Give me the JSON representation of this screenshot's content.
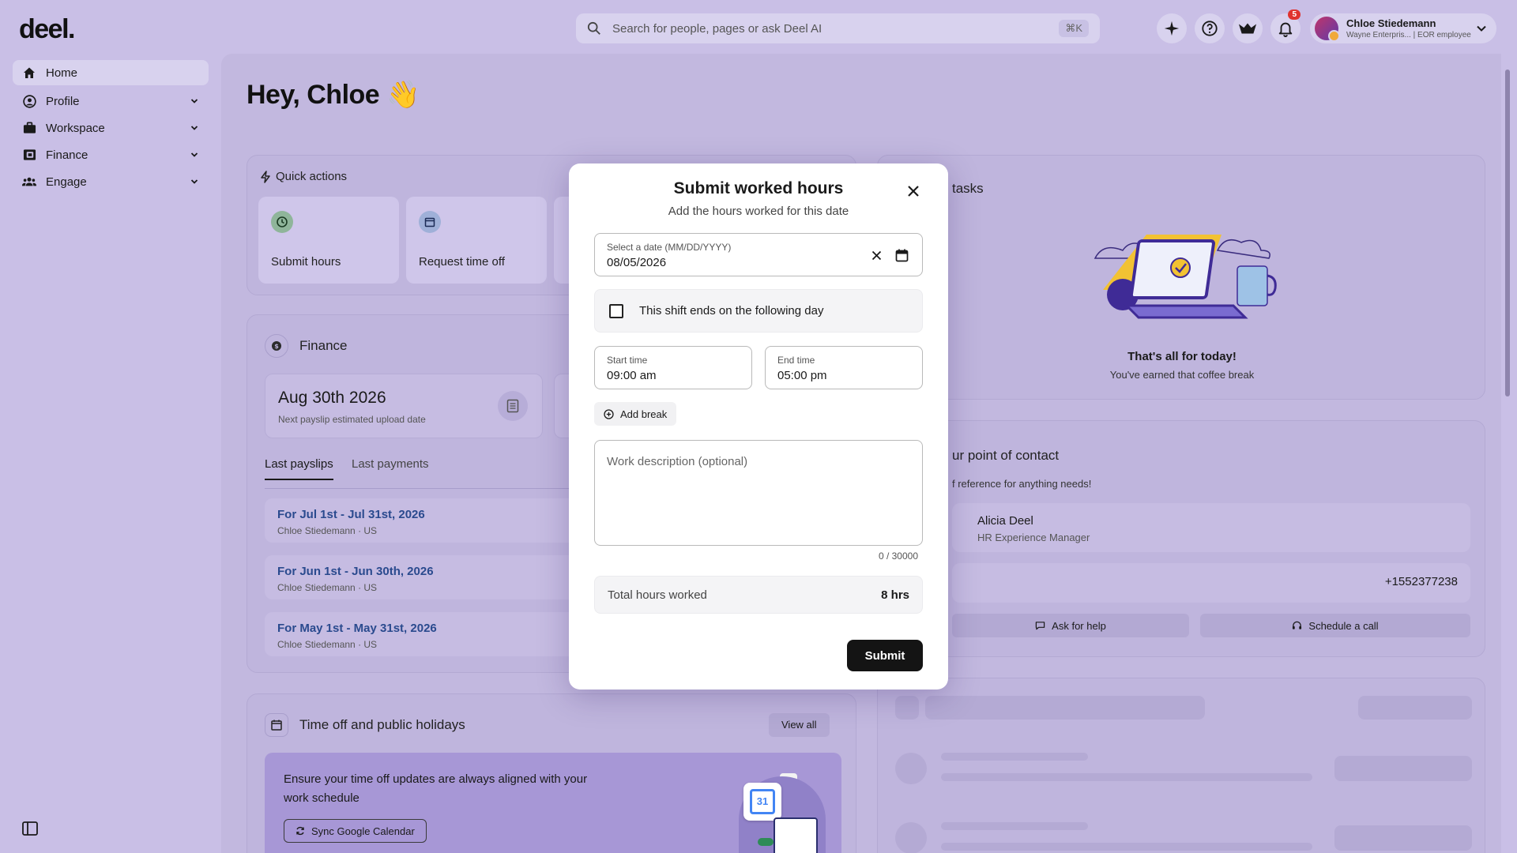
{
  "app": {
    "logo": "deel."
  },
  "topbar": {
    "search_placeholder": "Search for people, pages or ask Deel AI",
    "search_shortcut": "⌘K",
    "icons": [
      "ai-sparkle-icon",
      "help-icon",
      "explore-icon",
      "bell-icon"
    ],
    "notifications_count": "5",
    "user": {
      "name": "Chloe Stiedemann",
      "role": "Wayne Enterpris... | EOR employee"
    }
  },
  "sidebar": {
    "items": [
      {
        "label": "Home",
        "icon": "home-icon",
        "active": true,
        "expandable": false
      },
      {
        "label": "Profile",
        "icon": "profile-icon",
        "active": false,
        "expandable": true
      },
      {
        "label": "Workspace",
        "icon": "briefcase-icon",
        "active": false,
        "expandable": true
      },
      {
        "label": "Finance",
        "icon": "finance-icon",
        "active": false,
        "expandable": true
      },
      {
        "label": "Engage",
        "icon": "people-icon",
        "active": false,
        "expandable": true
      }
    ]
  },
  "main": {
    "greeting": "Hey, Chloe 👋",
    "quick_actions": {
      "title": "Quick actions",
      "tiles": [
        {
          "label": "Submit hours",
          "icon": "clock-icon"
        },
        {
          "label": "Request time off",
          "icon": "calendar-icon"
        }
      ]
    },
    "finance": {
      "title": "Finance",
      "next_payslip_date": "Aug 30th 2026",
      "next_payslip_caption": "Next payslip estimated upload date",
      "tabs": [
        "Last payslips",
        "Last payments"
      ],
      "payslips": [
        {
          "title": "For Jul 1st - Jul 31st, 2026",
          "subtitle": "Chloe Stiedemann · US"
        },
        {
          "title": "For Jun 1st - Jun 30th, 2026",
          "subtitle": "Chloe Stiedemann · US"
        },
        {
          "title": "For May 1st - May 31st, 2026",
          "subtitle": "Chloe Stiedemann · US"
        }
      ]
    },
    "time_off": {
      "title": "Time off and public holidays",
      "view_all": "View all",
      "banner_text": "Ensure your time off updates are always aligned with your work schedule",
      "sync_button": "Sync Google Calendar",
      "calendar_day": "31"
    },
    "tasks": {
      "title_partial": "tasks",
      "empty_title": "That's all for today!",
      "empty_subtitle": "You've earned that coffee break"
    },
    "contact": {
      "title_partial": "ur point of contact",
      "subtitle_partial": "f reference for anything needs!",
      "name": "Alicia Deel",
      "role": "HR Experience Manager",
      "phone": "+1552377238",
      "ask_help": "Ask for help",
      "schedule_call": "Schedule a call"
    }
  },
  "modal": {
    "title": "Submit worked hours",
    "subtitle": "Add the hours worked for this date",
    "date_label": "Select a date (MM/DD/YYYY)",
    "date_value": "08/05/2026",
    "shift_checkbox_label": "This shift ends on the following day",
    "shift_checked": false,
    "start_label": "Start time",
    "start_value": "09:00 am",
    "end_label": "End time",
    "end_value": "05:00 pm",
    "add_break": "Add break",
    "description_placeholder": "Work description (optional)",
    "char_counter": "0 / 30000",
    "total_label": "Total hours worked",
    "total_value": "8 hrs",
    "submit": "Submit"
  }
}
